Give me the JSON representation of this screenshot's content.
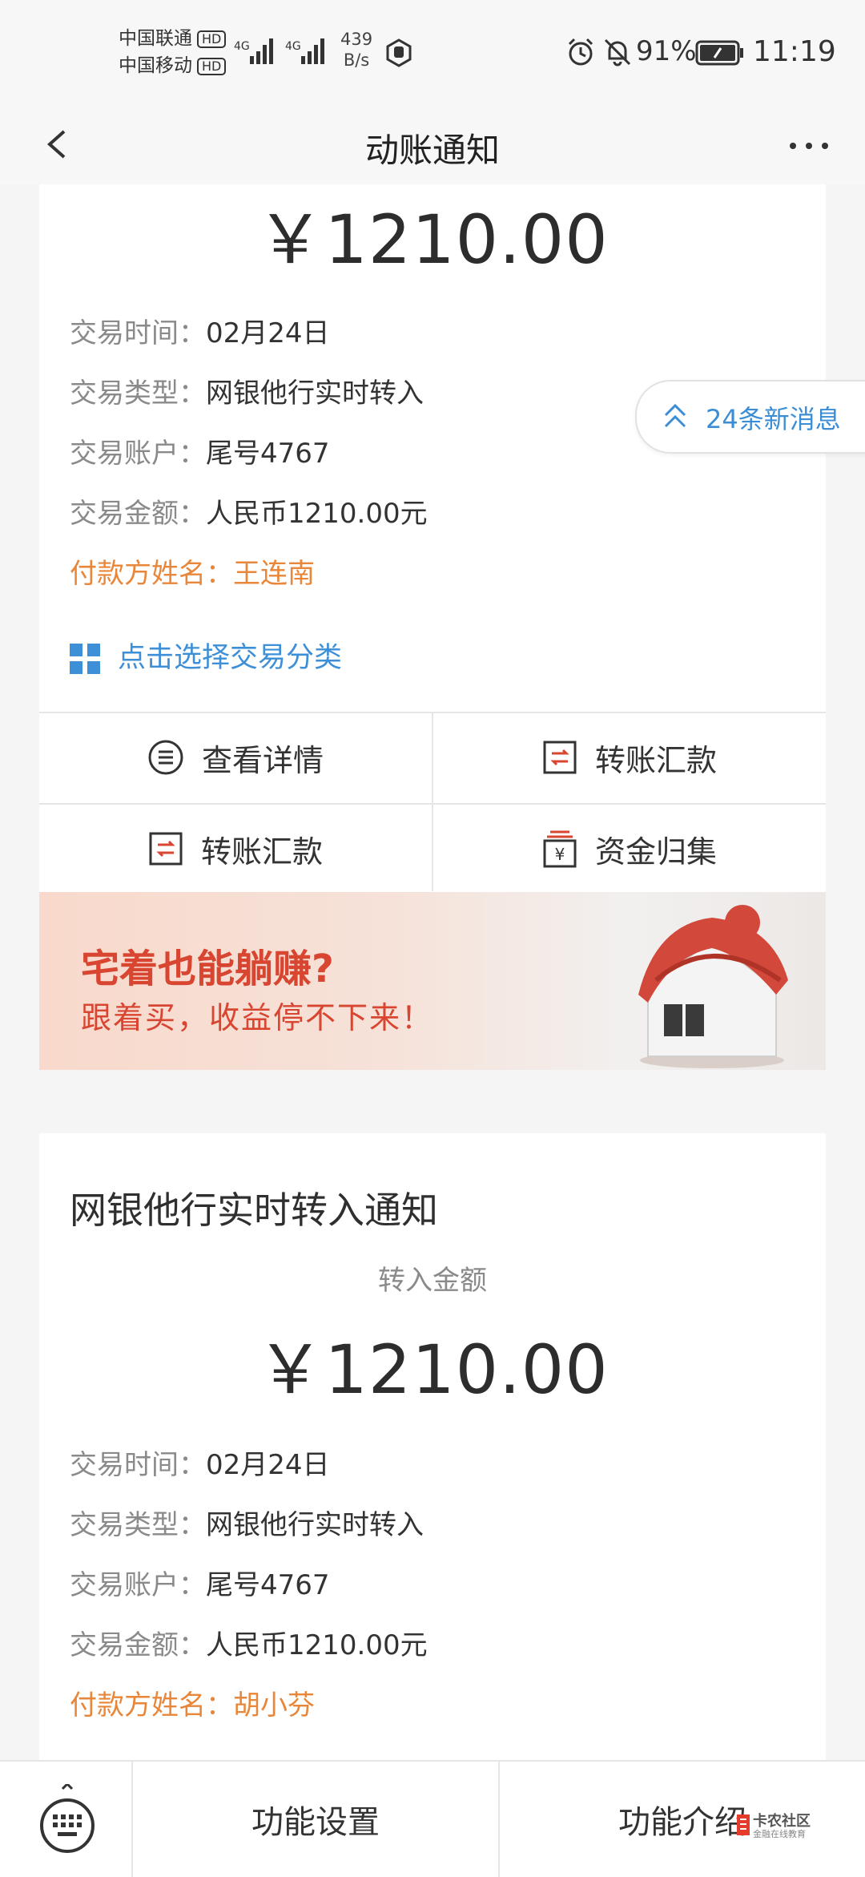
{
  "status_bar": {
    "carrier1": "中国联通",
    "carrier2": "中国移动",
    "hd": "HD",
    "net1": "4G",
    "net2": "4G",
    "speed_value": "439",
    "speed_unit": "B/s",
    "battery": "91%",
    "time": "11:19"
  },
  "header": {
    "title": "动账通知",
    "more": "···"
  },
  "card1": {
    "amount": "￥1210.00",
    "rows": [
      {
        "key": "交易时间：",
        "value": "02月24日"
      },
      {
        "key": "交易类型：",
        "value": "网银他行实时转入"
      },
      {
        "key": "交易账户：",
        "value": "尾号4767"
      },
      {
        "key": "交易金额：",
        "value": "人民币1210.00元"
      }
    ],
    "payer": {
      "key": "付款方姓名：",
      "value": "王连南"
    },
    "classify": "点击选择交易分类",
    "actions": [
      "查看详情",
      "转账汇款",
      "转账汇款",
      "资金归集"
    ],
    "banner": {
      "title": "宅着也能躺赚?",
      "subtitle": "跟着买，收益停不下来！"
    }
  },
  "new_messages": "24条新消息",
  "card2": {
    "title": "网银他行实时转入通知",
    "amount_label": "转入金额",
    "amount": "￥1210.00",
    "rows": [
      {
        "key": "交易时间：",
        "value": "02月24日"
      },
      {
        "key": "交易类型：",
        "value": "网银他行实时转入"
      },
      {
        "key": "交易账户：",
        "value": "尾号4767"
      },
      {
        "key": "交易金额：",
        "value": "人民币1210.00元"
      }
    ],
    "payer": {
      "key": "付款方姓名：",
      "value": "胡小芬"
    }
  },
  "bottom_nav": {
    "settings": "功能设置",
    "intro": "功能介绍"
  },
  "watermark": {
    "line1": "卡农社区",
    "line2": "金融在线教育"
  },
  "colors": {
    "accent_blue": "#3d8fd8",
    "payer_orange": "#e8873a",
    "banner_red": "#d84631"
  }
}
